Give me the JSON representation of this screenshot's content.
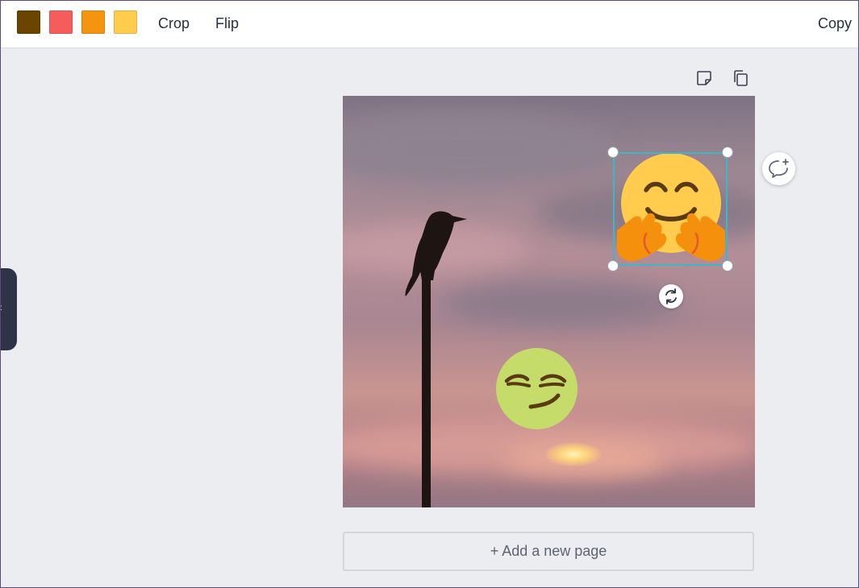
{
  "toolbar": {
    "swatches": [
      {
        "name": "brown",
        "color": "#6b4500"
      },
      {
        "name": "coral",
        "color": "#f65c5c"
      },
      {
        "name": "orange",
        "color": "#f5950f"
      },
      {
        "name": "yellow",
        "color": "#ffcc4d"
      }
    ],
    "crop_label": "Crop",
    "flip_label": "Flip",
    "copy_label": "Copy"
  },
  "side_tab": {
    "icon": "chevron-left-icon",
    "glyph": "‹"
  },
  "page_tools": [
    {
      "icon": "sticky-note-icon"
    },
    {
      "icon": "duplicate-page-icon"
    }
  ],
  "canvas": {
    "background": "sunset sky photo with crow on pole",
    "elements": [
      {
        "icon": "hugging-face-emoji",
        "selected": true
      },
      {
        "icon": "smirking-face-emoji",
        "selected": false
      }
    ]
  },
  "comment": {
    "icon": "add-comment-icon"
  },
  "rotate": {
    "icon": "rotate-icon"
  },
  "add_page_label": "+ Add a new page"
}
